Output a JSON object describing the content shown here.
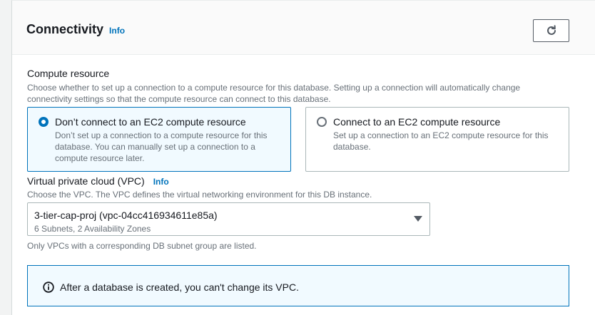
{
  "header": {
    "title": "Connectivity",
    "info_label": "Info",
    "refresh_icon": "refresh-icon"
  },
  "compute": {
    "label": "Compute resource",
    "description_line1": "Choose whether to set up a connection to a compute resource for this database. Setting up a connection will automatically change",
    "description_line2": "connectivity settings so that the compute resource can connect to this database.",
    "options": [
      {
        "title": "Don’t connect to an EC2 compute resource",
        "desc_line1": "Don’t set up a connection to a compute resource for this",
        "desc_line2": "database. You can manually set up a connection to a",
        "desc_line3": "compute resource later.",
        "selected": true
      },
      {
        "title": "Connect to an EC2 compute resource",
        "desc_line1": "Set up a connection to an EC2 compute resource for this",
        "desc_line2": "database.",
        "selected": false
      }
    ]
  },
  "vpc": {
    "label": "Virtual private cloud (VPC)",
    "info_label": "Info",
    "description": "Choose the VPC. The VPC defines the virtual networking environment for this DB instance.",
    "selected_value": "3-tier-cap-proj (vpc-04cc416934611e85a)",
    "selected_sub": "6 Subnets, 2 Availability Zones",
    "constraint": "Only VPCs with a corresponding DB subnet group are listed."
  },
  "alert": {
    "icon": "info-icon",
    "text": "After a database is created, you can't change its VPC."
  },
  "colors": {
    "accent": "#0073bb",
    "alert_bg": "#f1faff",
    "text": "#16191f",
    "secondary_text": "#687078"
  }
}
